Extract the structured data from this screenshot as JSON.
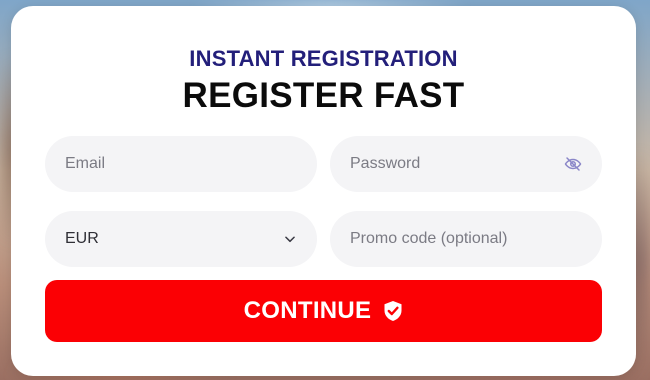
{
  "form": {
    "subtitle": "INSTANT REGISTRATION",
    "title": "REGISTER FAST",
    "email": {
      "placeholder": "Email",
      "value": ""
    },
    "password": {
      "placeholder": "Password",
      "value": "",
      "toggle_icon": "eye-off-icon"
    },
    "currency": {
      "selected": "EUR",
      "icon": "chevron-down-icon"
    },
    "promo": {
      "placeholder": "Promo code (optional)",
      "value": ""
    },
    "continue_button": {
      "label": "CONTINUE",
      "icon": "shield-check-icon"
    }
  },
  "colors": {
    "accent": "#fb0004",
    "subtitle": "#231f7a",
    "title": "#0b0b0b",
    "field_bg": "#f4f4f6",
    "icon": "#8a86c8"
  }
}
